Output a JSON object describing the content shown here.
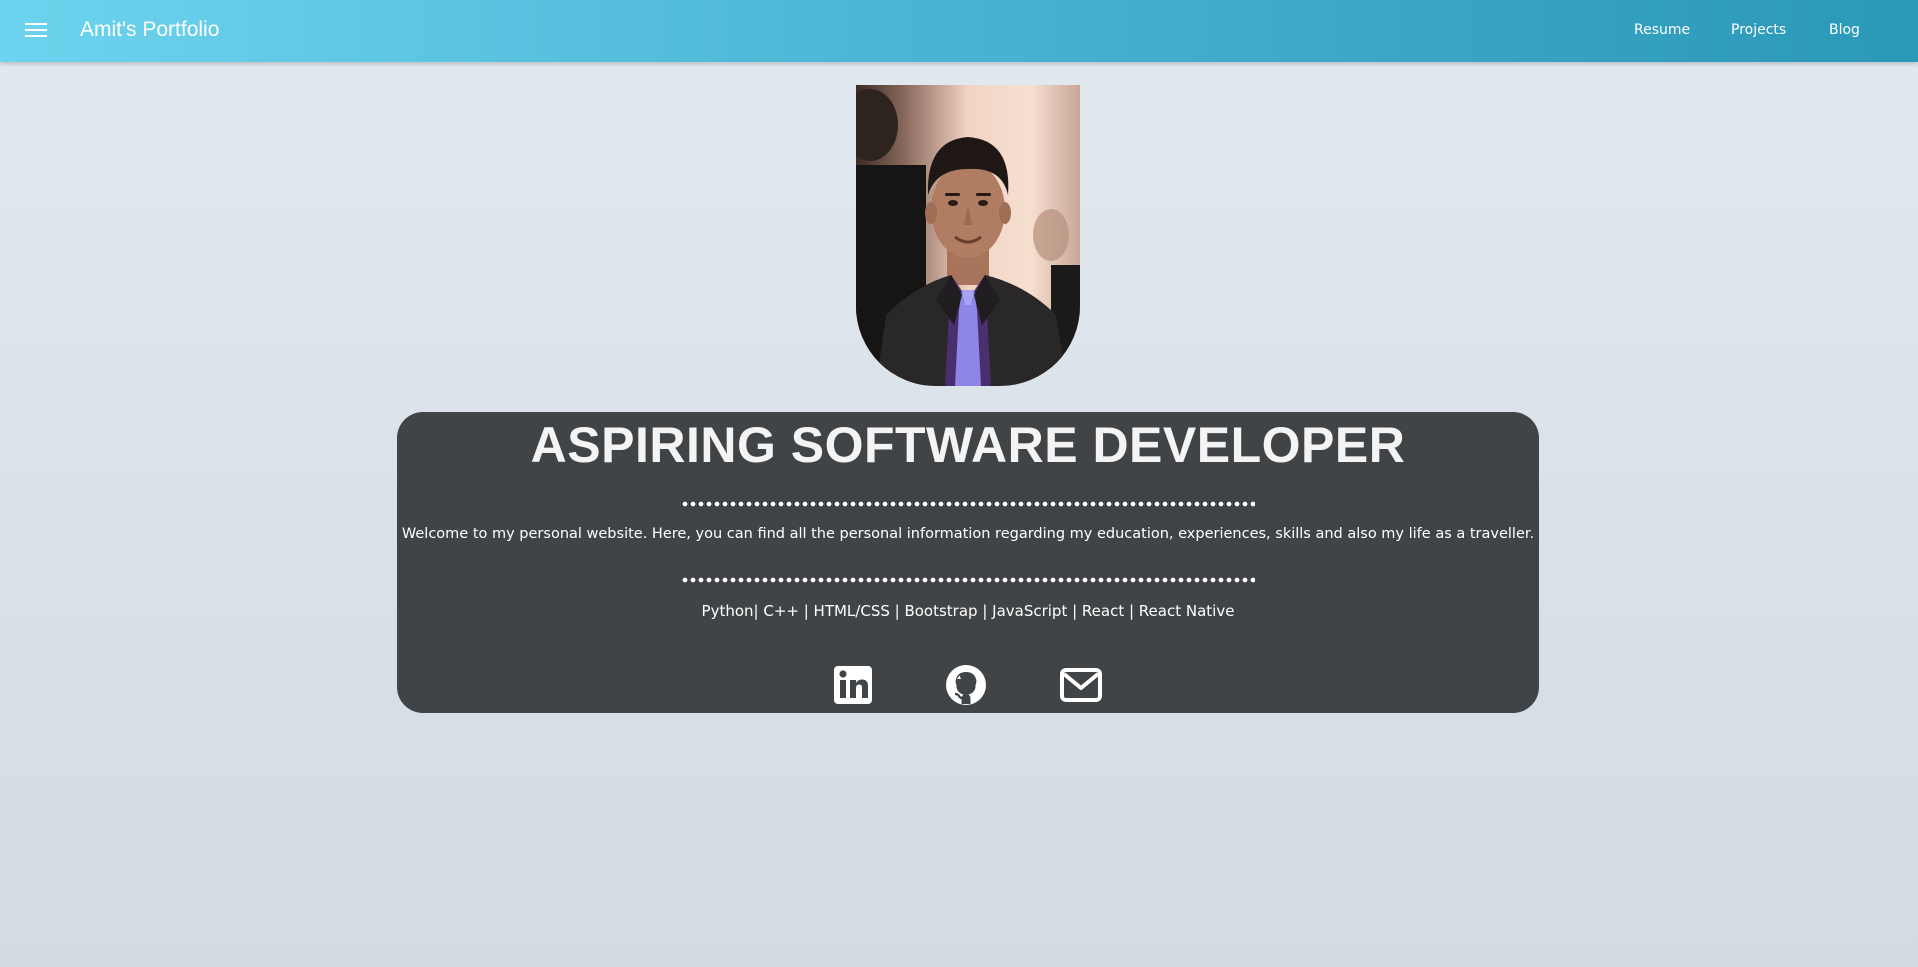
{
  "navbar": {
    "menu_icon": "hamburger-menu-icon",
    "brand": "Amit's Portfolio",
    "links": [
      "Resume",
      "Projects",
      "Blog"
    ],
    "gradient_colors": [
      "#6dd4ee",
      "#2a98b7"
    ]
  },
  "hero": {
    "photo_description": "profile-photo",
    "headline": "ASPIRING SOFTWARE DEVELOPER",
    "intro": "Welcome to my personal website. Here, you can find all the personal information regarding my education, experiences, skills and also my life as a traveller.",
    "skills": "Python| C++ | HTML/CSS | Bootstrap | JavaScript | React | React Native",
    "card_color": "#414446",
    "social_icons": [
      "linkedin-icon",
      "github-icon",
      "email-icon"
    ]
  }
}
